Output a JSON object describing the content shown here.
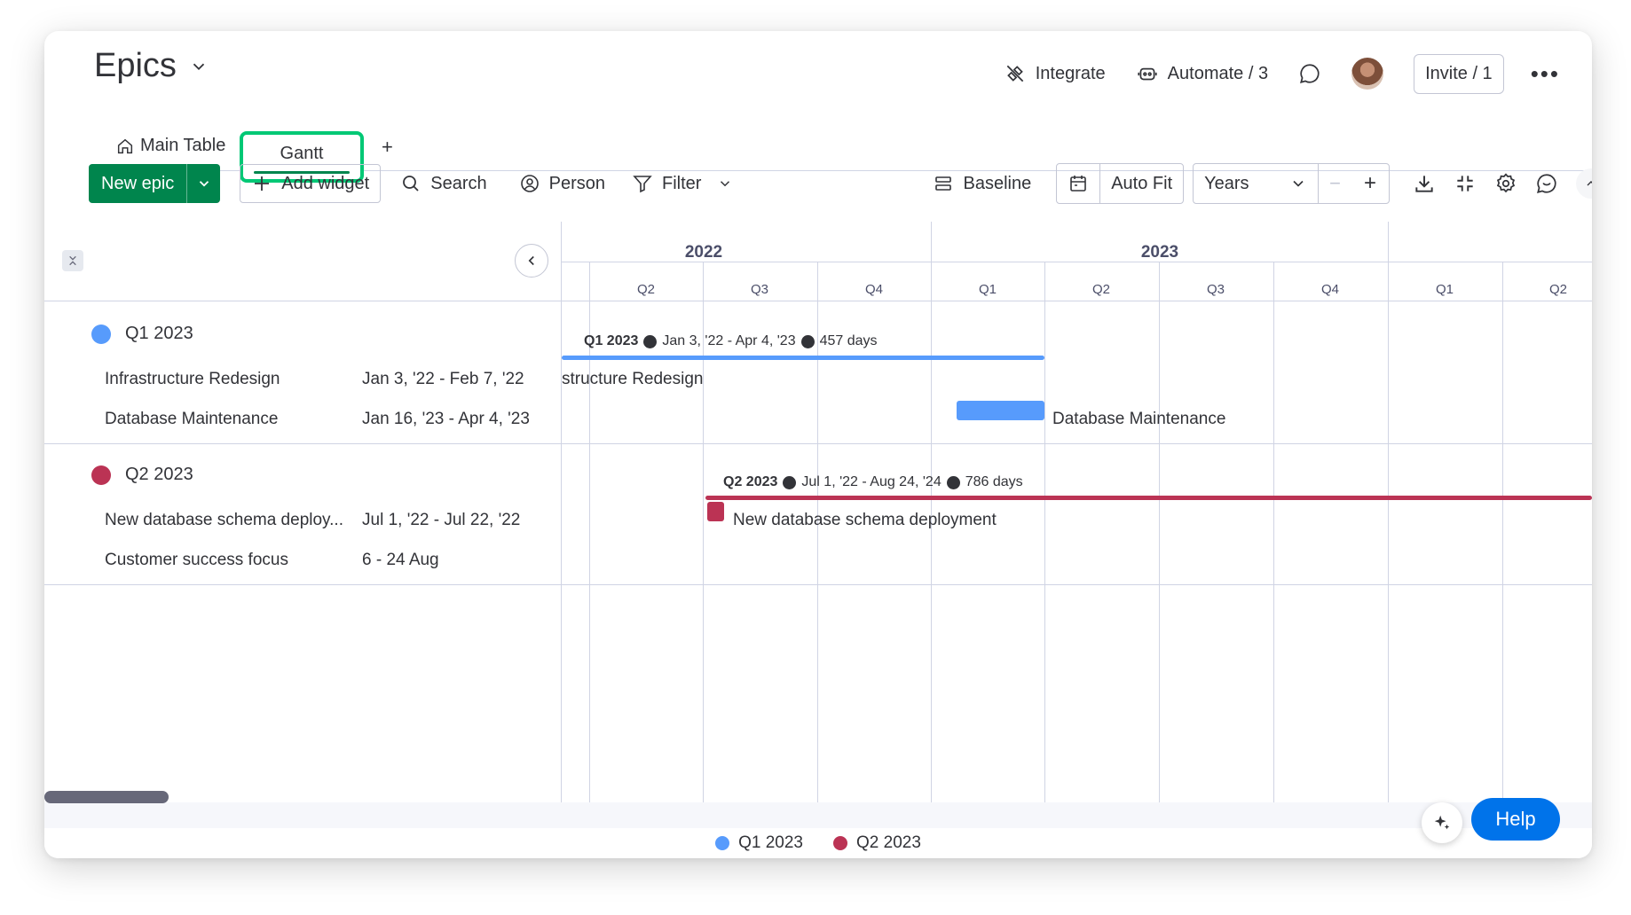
{
  "board": {
    "title": "Epics"
  },
  "topbar": {
    "integrate": "Integrate",
    "automate": "Automate / 3",
    "invite": "Invite / 1"
  },
  "tabs": {
    "main": "Main Table",
    "gantt": "Gantt",
    "add": "+"
  },
  "toolbar": {
    "new_epic": "New epic",
    "add_widget": "Add widget",
    "search": "Search",
    "person": "Person",
    "filter": "Filter",
    "baseline": "Baseline",
    "auto_fit": "Auto Fit",
    "zoom_select": "Years",
    "zoom_out": "−",
    "zoom_in": "+"
  },
  "timeline": {
    "years": [
      "2022",
      "2023"
    ],
    "quarters": [
      "Q2",
      "Q3",
      "Q4",
      "Q1",
      "Q2",
      "Q3",
      "Q4",
      "Q1",
      "Q2"
    ]
  },
  "groups": [
    {
      "name": "Q1 2023",
      "color": "#579bfc",
      "summary_name": "Q1 2023",
      "summary_range": "Jan 3, '22 - Apr 4, '23",
      "summary_days": "457 days",
      "items": [
        {
          "name": "Infrastructure Redesign",
          "dates": "Jan 3, '22 - Feb 7, '22",
          "bar_label": "structure Redesign"
        },
        {
          "name": "Database Maintenance",
          "dates": "Jan 16, '23 - Apr 4, '23",
          "bar_label": "Database Maintenance"
        }
      ]
    },
    {
      "name": "Q2 2023",
      "color": "#bb3354",
      "summary_name": "Q2 2023",
      "summary_range": "Jul 1, '22 - Aug 24, '24",
      "summary_days": "786 days",
      "items": [
        {
          "name": "New database schema deploy...",
          "dates": "Jul 1, '22 - Jul 22, '22",
          "bar_label": "New database schema deployment"
        },
        {
          "name": "Customer success focus",
          "dates": "6 - 24 Aug",
          "bar_label": ""
        }
      ]
    }
  ],
  "legend": [
    "Q1 2023",
    "Q2 2023"
  ],
  "help": "Help"
}
